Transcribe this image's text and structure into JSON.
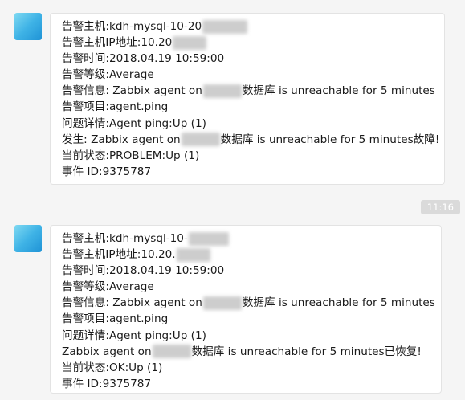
{
  "messages": [
    {
      "lines": {
        "host": "告警主机:kdh-mysql-10-20",
        "ip": "告警主机IP地址:10.20",
        "time": "告警时间:2018.04.19 10:59:00",
        "level": "告警等级:Average",
        "info_pre": "告警信息: Zabbix agent on",
        "info_post": "数据库 is unreachable for 5 minutes",
        "item": "告警项目:agent.ping",
        "detail": "问题详情:Agent ping:Up (1)",
        "event_pre": "发生: Zabbix agent on",
        "event_post": "数据库 is unreachable for 5 minutes故障!",
        "status": "当前状态:PROBLEM:Up (1)",
        "event_id": "事件 ID:9375787"
      }
    },
    {
      "lines": {
        "host": "告警主机:kdh-mysql-10-",
        "ip": "告警主机IP地址:10.20.",
        "time": "告警时间:2018.04.19 10:59:00",
        "level": "告警等级:Average",
        "info_pre": "告警信息: Zabbix agent on",
        "info_post": "数据库 is unreachable for 5 minutes",
        "item": "告警项目:agent.ping",
        "detail": "问题详情:Agent ping:Up (1)",
        "event_pre": "Zabbix agent on",
        "event_post": "数据库 is unreachable for 5 minutes已恢复!",
        "status": "当前状态:OK:Up (1)",
        "event_id": "事件 ID:9375787"
      }
    }
  ],
  "timestamp": "11:16"
}
